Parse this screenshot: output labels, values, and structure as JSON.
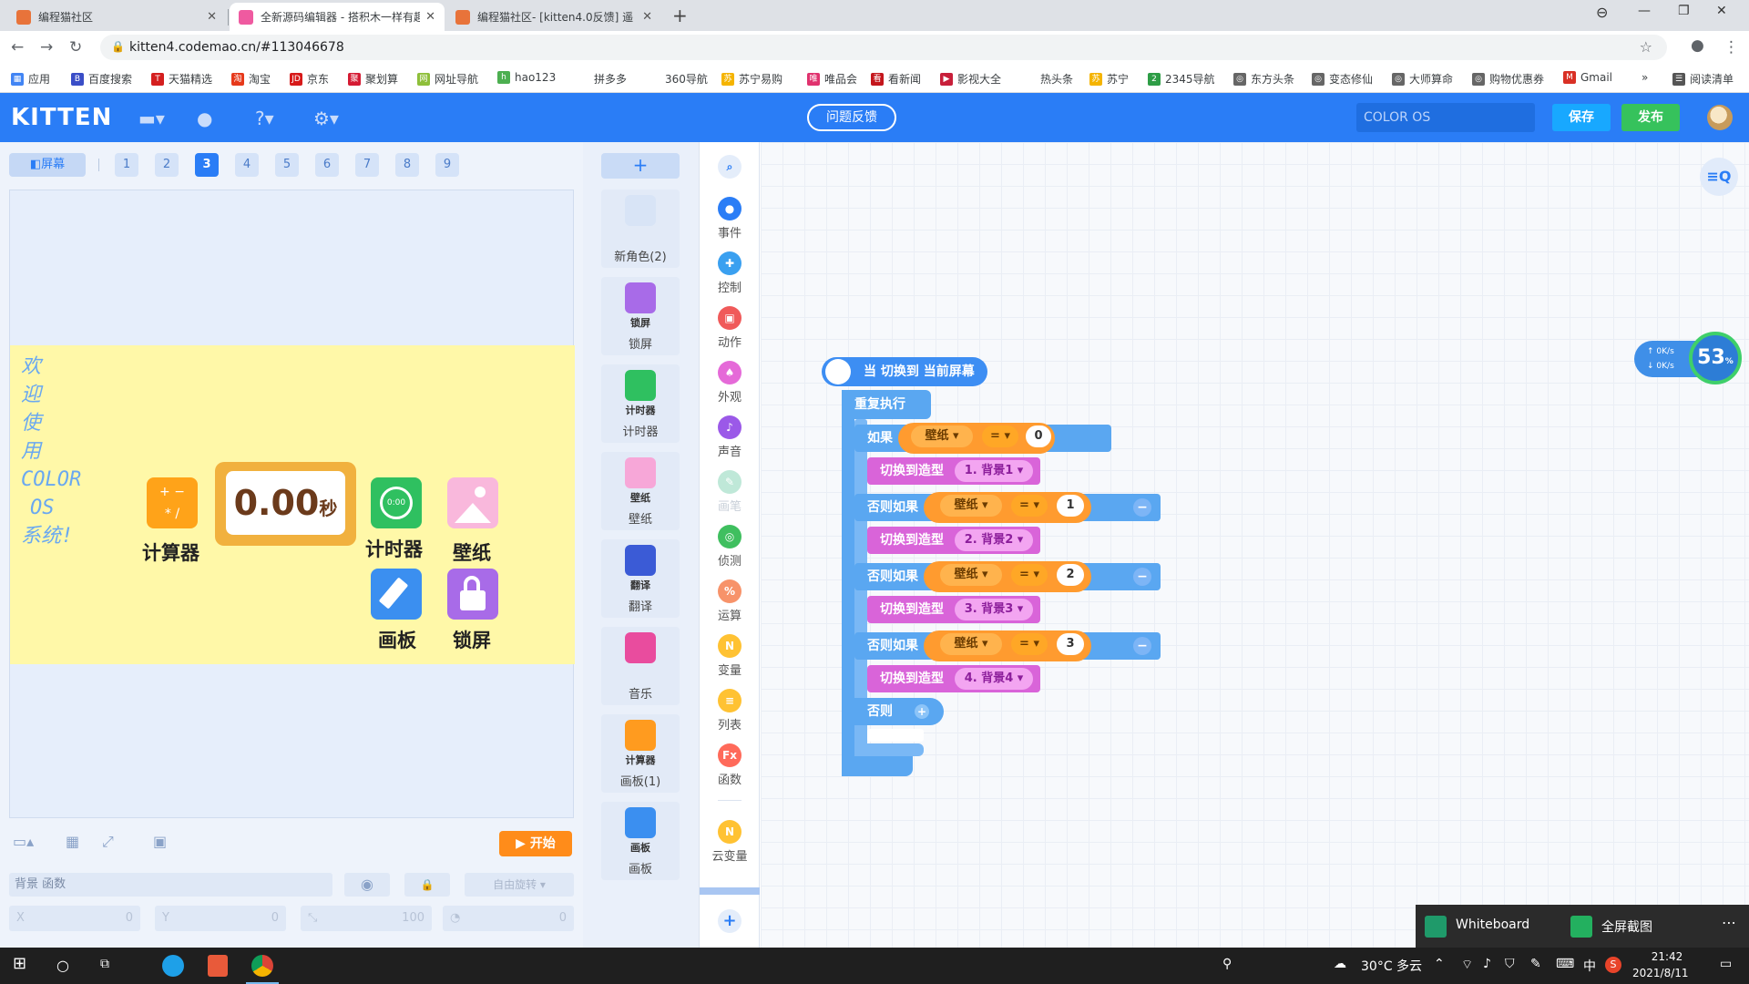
{
  "browser": {
    "tabs": [
      {
        "title": "编程猫社区",
        "active": false
      },
      {
        "title": "全新源码编辑器 - 搭积木一样有趣",
        "active": true
      },
      {
        "title": "编程猫社区- [kitten4.0反馈] 遥",
        "active": false
      }
    ],
    "url": "kitten4.codemao.cn/#113046678",
    "bookmarks": [
      "应用",
      "百度搜索",
      "天猫精选",
      "淘宝",
      "京东",
      "聚划算",
      "网址导航",
      "hao123",
      "拼多多",
      "360导航",
      "苏宁易购",
      "唯品会",
      "看新闻",
      "影视大全",
      "热头条",
      "苏宁",
      "2345导航",
      "东方头条",
      "变态修仙",
      "大师算命",
      "购物优惠券",
      "Gmail",
      "»",
      "阅读清单"
    ]
  },
  "app": {
    "logo": "KITTEN",
    "feedback_label": "问题反馈",
    "project_name": "COLOR OS",
    "save_label": "保存",
    "publish_label": "发布"
  },
  "stage": {
    "screen_button": "屏幕",
    "pages": [
      "1",
      "2",
      "3",
      "4",
      "5",
      "6",
      "7",
      "8",
      "9"
    ],
    "current_page": "3",
    "welcome_lines": [
      "欢",
      "迎",
      "使",
      "用",
      "COLOR",
      "OS",
      "系统!"
    ],
    "apps": {
      "calculator": "计算器",
      "timer": "计时器",
      "wallpaper": "壁纸",
      "canvas": "画板",
      "lockscreen": "锁屏"
    },
    "timer_value": "0.00",
    "timer_unit": "秒",
    "start_label": "开始",
    "property_placeholder": "背景 函数",
    "rotate_label": "自由旋转",
    "x_label": "X",
    "x_value": "0",
    "y_label": "Y",
    "y_value": "0",
    "size_value": "100",
    "direction_value": "0"
  },
  "sprites": [
    {
      "label": "新角色(2)",
      "icon_text": "",
      "color": "#d8e4f6"
    },
    {
      "label": "锁屏",
      "icon_text": "锁屏",
      "color": "#a86be8"
    },
    {
      "label": "计时器",
      "icon_text": "计时器",
      "color": "#2fc060"
    },
    {
      "label": "壁纸",
      "icon_text": "壁纸",
      "color": "#f7a7d8"
    },
    {
      "label": "翻译",
      "icon_text": "翻译",
      "color": "#3b5bd6"
    },
    {
      "label": "音乐",
      "icon_text": "音乐",
      "color": "#e94c9e"
    },
    {
      "label": "画板(1)",
      "icon_text": "计算器",
      "color": "#ff9b1f"
    },
    {
      "label": "画板",
      "icon_text": "画板",
      "color": "#3b8ff0"
    }
  ],
  "categories": [
    {
      "label": "事件",
      "color": "#2a7df6"
    },
    {
      "label": "控制",
      "color": "#3aa0f0"
    },
    {
      "label": "动作",
      "color": "#f05a5a"
    },
    {
      "label": "外观",
      "color": "#e56ad8"
    },
    {
      "label": "声音",
      "color": "#9b59e8"
    },
    {
      "label": "画笔",
      "color": "#bfe8d8"
    },
    {
      "label": "侦测",
      "color": "#3fbf5f"
    },
    {
      "label": "运算",
      "color": "#f7936a"
    },
    {
      "label": "变量",
      "color": "#ffc233"
    },
    {
      "label": "列表",
      "color": "#ffc233"
    },
    {
      "label": "函数",
      "color": "#ff6a5a"
    },
    {
      "label": "云变量",
      "color": "#ffc233"
    }
  ],
  "script": {
    "hat": "当 切换到 当前屏幕",
    "loop": "重复执行",
    "if_label": "如果",
    "elseif_label": "否则如果",
    "else_label": "否则",
    "var_name": "壁纸",
    "op": "=",
    "switch_label": "切换到造型",
    "branches": [
      {
        "value": "0",
        "costume": "1. 背景1"
      },
      {
        "value": "1",
        "costume": "2. 背景2"
      },
      {
        "value": "2",
        "costume": "3. 背景3"
      },
      {
        "value": "3",
        "costume": "4. 背景4"
      }
    ]
  },
  "netwidget": {
    "up": "0",
    "down": "0",
    "unit": "K/s",
    "percent": "53"
  },
  "notification": {
    "left_app": "Whiteboard",
    "right_app": "全屏截图"
  },
  "taskbar": {
    "weather": "30°C 多云",
    "time": "21:42",
    "date": "2021/8/11",
    "ime": "中"
  }
}
